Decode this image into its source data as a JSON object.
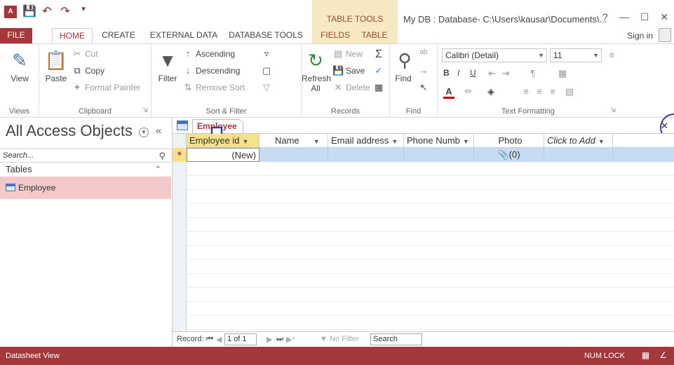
{
  "titlebar": {
    "app_icon": "A",
    "qat_icons": [
      "save-icon",
      "undo-icon",
      "redo-icon",
      "customize-icon"
    ],
    "table_tools": "TABLE TOOLS",
    "window_title": "My DB : Database- C:\\Users\\kausar\\Documents\\...",
    "controls": [
      "?",
      "—",
      "☐",
      "✕"
    ]
  },
  "tabs": {
    "file": "FILE",
    "home": "HOME",
    "create": "CREATE",
    "external_data": "EXTERNAL DATA",
    "database_tools": "DATABASE TOOLS",
    "fields": "FIELDS",
    "table": "TABLE",
    "sign_in": "Sign in"
  },
  "ribbon": {
    "views": {
      "view": "View",
      "label": "Views"
    },
    "clipboard": {
      "paste": "Paste",
      "cut": "Cut",
      "copy": "Copy",
      "format_painter": "Format Painter",
      "label": "Clipboard"
    },
    "sort_filter": {
      "filter": "Filter",
      "ascending": "Ascending",
      "descending": "Descending",
      "remove_sort": "Remove Sort",
      "label": "Sort & Filter"
    },
    "records": {
      "refresh": "Refresh",
      "refresh_sub": "All",
      "new": "New",
      "save": "Save",
      "delete": "Delete",
      "label": "Records"
    },
    "find": {
      "find": "Find",
      "label": "Find"
    },
    "text_formatting": {
      "font": "Calibri (Detail)",
      "size": "11",
      "bold": "B",
      "italic": "I",
      "underline": "U",
      "label": "Text Formatting"
    }
  },
  "nav": {
    "title": "All Access Objects",
    "search_placeholder": "Search...",
    "section": "Tables",
    "items": [
      {
        "label": "Employee"
      }
    ]
  },
  "document": {
    "tab_label": "Employee",
    "columns": [
      "Employee id",
      "Name",
      "Email address",
      "Phone Numb",
      "Photo",
      "Click to Add"
    ],
    "new_row": {
      "id": "(New)",
      "photo": "(0)"
    }
  },
  "record_nav": {
    "label": "Record:",
    "current": "1 of 1",
    "filter": "No Filter",
    "search": "Search"
  },
  "status": {
    "left": "Datasheet View",
    "num_lock": "NUM LOCK"
  },
  "colors": {
    "accent": "#a4373a",
    "table_tools_band": "#f6e8c0",
    "selected_nav": "#f3c9c9",
    "new_row": "#c7dcf3",
    "active_header": "#f6e08a"
  }
}
